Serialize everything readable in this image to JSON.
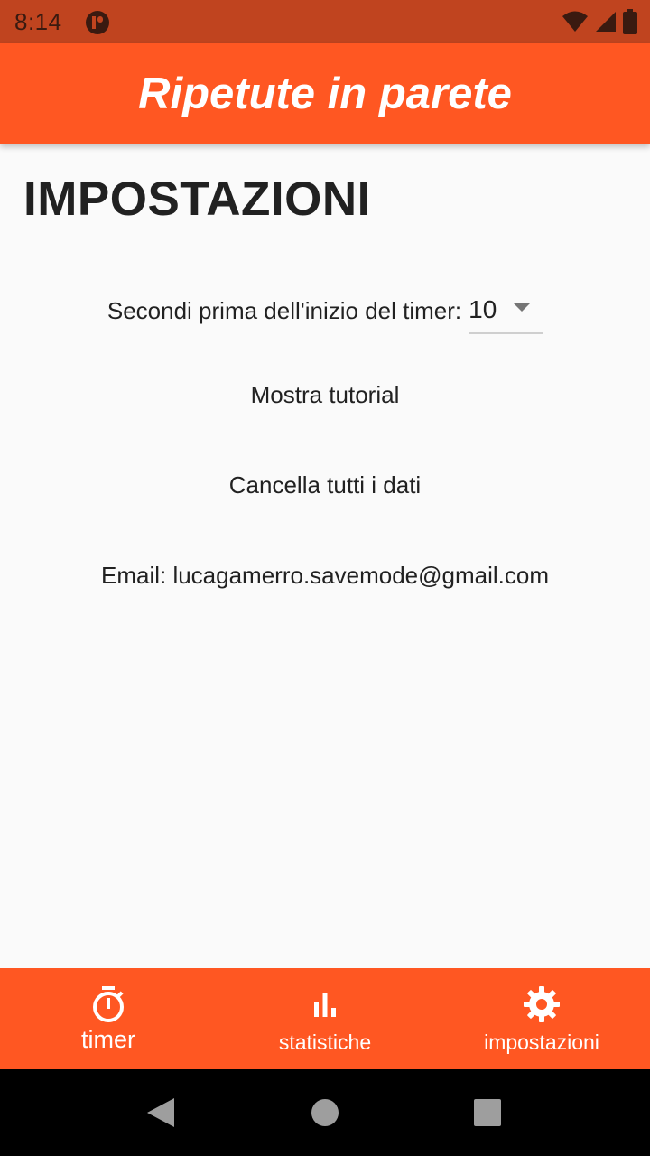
{
  "status_bar": {
    "time": "8:14",
    "icons": [
      "app-notification-icon",
      "wifi-icon",
      "signal-icon",
      "battery-icon"
    ]
  },
  "app_bar": {
    "title": "Ripetute in parete"
  },
  "settings": {
    "heading": "IMPOSTAZIONI",
    "countdown": {
      "label": "Secondi prima dell'inizio del timer:",
      "selected_value": "10"
    },
    "show_tutorial": "Mostra tutorial",
    "delete_all_data": "Cancella tutti i dati",
    "email": "Email: lucagamerro.savemode@gmail.com"
  },
  "bottom_nav": {
    "items": [
      {
        "label": "timer",
        "icon": "stopwatch-icon",
        "active": true
      },
      {
        "label": "statistiche",
        "icon": "bar-chart-icon",
        "active": false
      },
      {
        "label": "impostazioni",
        "icon": "gear-icon",
        "active": false
      }
    ]
  },
  "system_nav": {
    "buttons": [
      "back-icon",
      "home-icon",
      "recents-icon"
    ]
  },
  "colors": {
    "primary": "#ff5722",
    "status_bar": "#c0441f",
    "background": "#fafafa",
    "text": "#212121"
  }
}
